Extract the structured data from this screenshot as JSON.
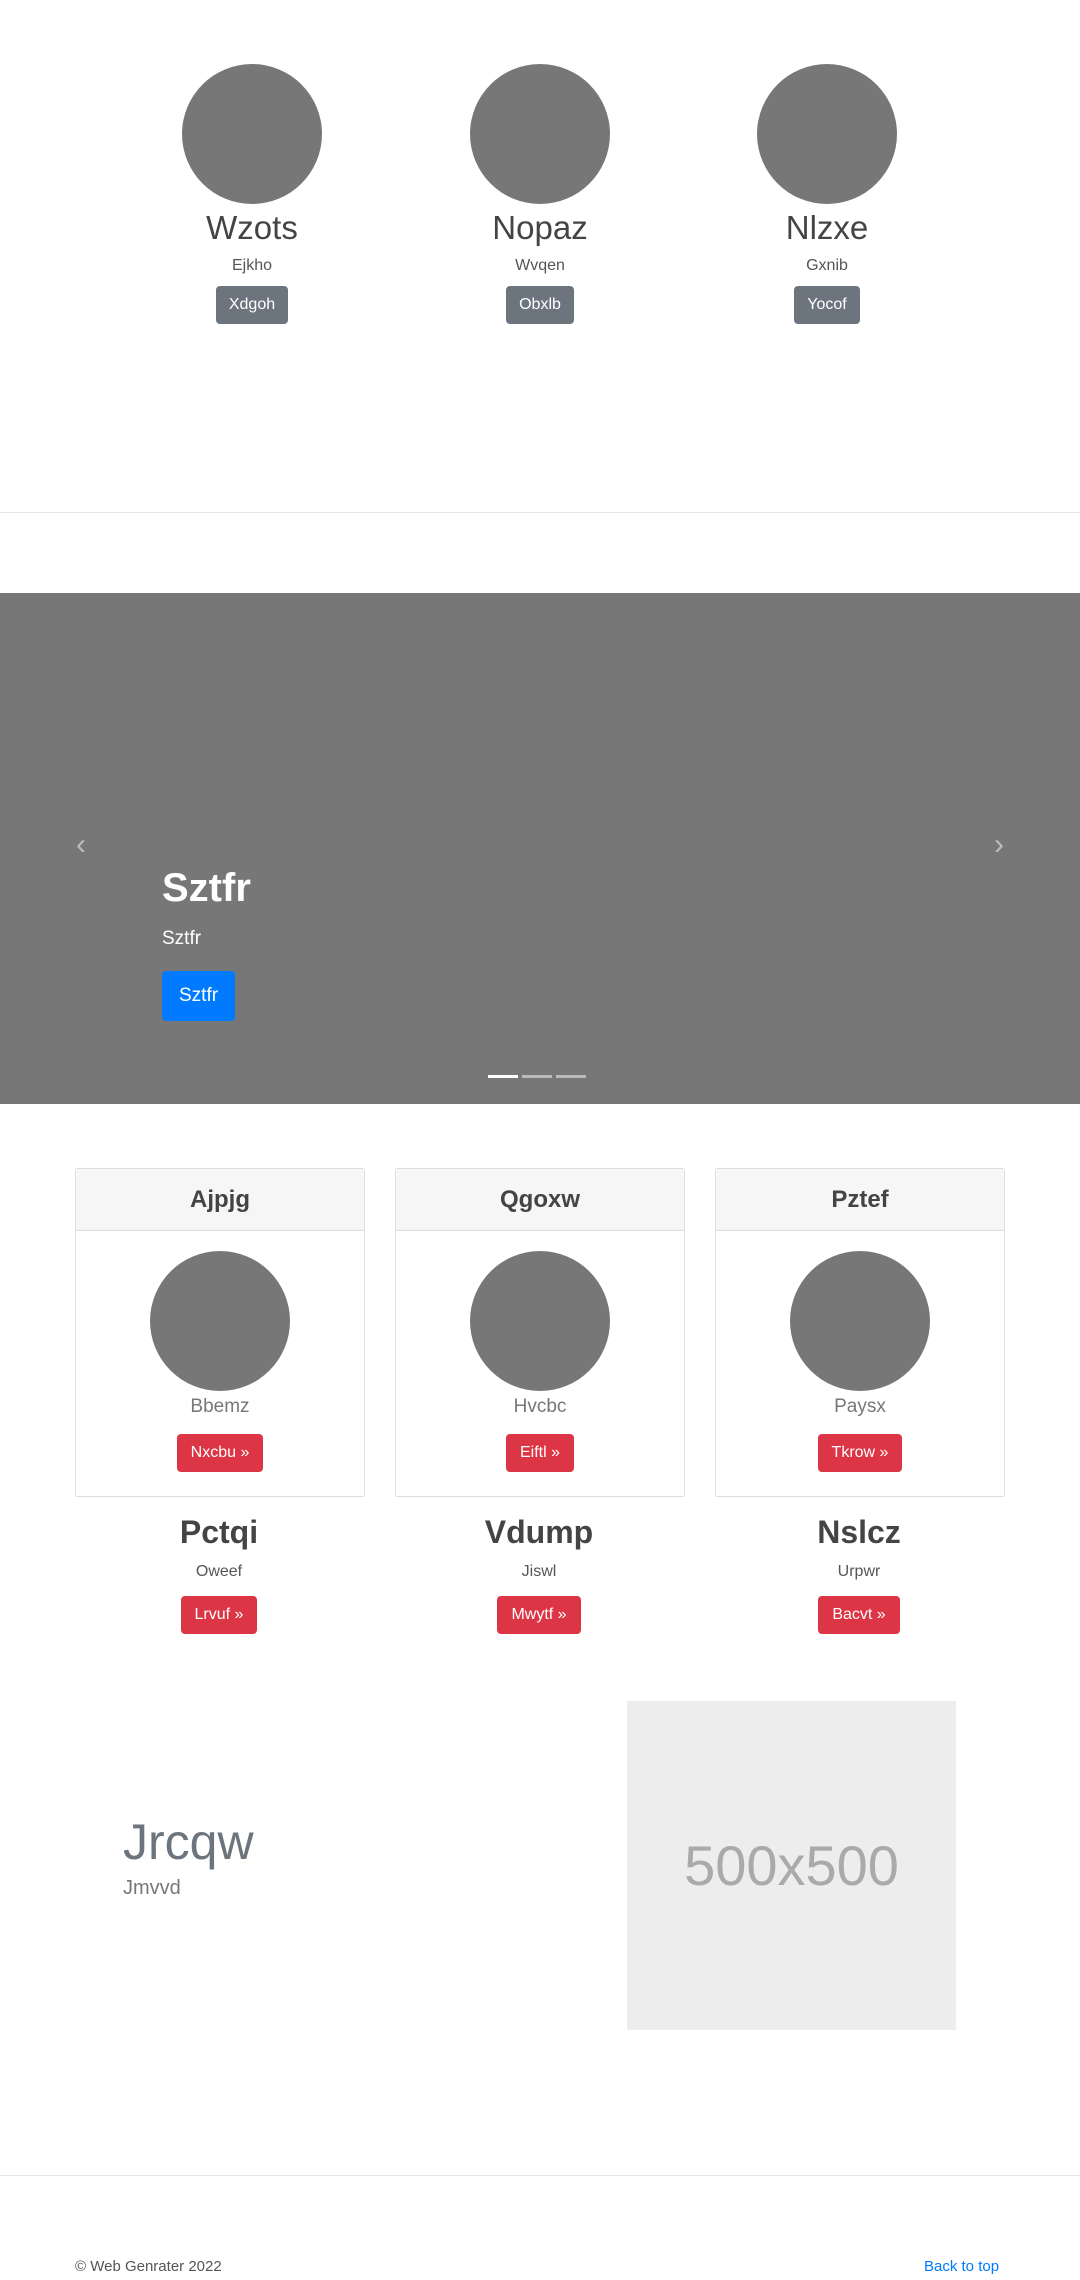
{
  "team": [
    {
      "name": "Wzots",
      "role": "Ejkho",
      "button": "Xdgoh"
    },
    {
      "name": "Nopaz",
      "role": "Wvqen",
      "button": "Obxlb"
    },
    {
      "name": "Nlzxe",
      "role": "Gxnib",
      "button": "Yocof"
    }
  ],
  "carousel": {
    "heading": "Sztfr",
    "text": "Sztfr",
    "button": "Sztfr",
    "prev_icon": "‹",
    "next_icon": "›",
    "slide_count": 3,
    "active_slide": 1
  },
  "cards": [
    {
      "header": "Ajpjg",
      "label": "Bbemz",
      "button": "Nxcbu »"
    },
    {
      "header": "Qgoxw",
      "label": "Hvcbc",
      "button": "Eiftl »"
    },
    {
      "header": "Pztef",
      "label": "Paysx",
      "button": "Tkrow »"
    }
  ],
  "highlights": [
    {
      "title": "Pctqi",
      "sub": "Oweef",
      "button": "Lrvuf »"
    },
    {
      "title": "Vdump",
      "sub": "Jiswl",
      "button": "Mwytf »"
    },
    {
      "title": "Nslcz",
      "sub": "Urpwr",
      "button": "Bacvt »"
    }
  ],
  "feature": {
    "heading": "Jrcqw",
    "sub": "Jmvvd",
    "image_placeholder": "500x500"
  },
  "footer": {
    "copyright": "© Web Genrater 2022",
    "back_to_top": "Back to top"
  },
  "colors": {
    "primary": "#007bff",
    "danger": "#dc3545",
    "secondary": "#6c757d",
    "placeholder_gray": "#777777"
  }
}
